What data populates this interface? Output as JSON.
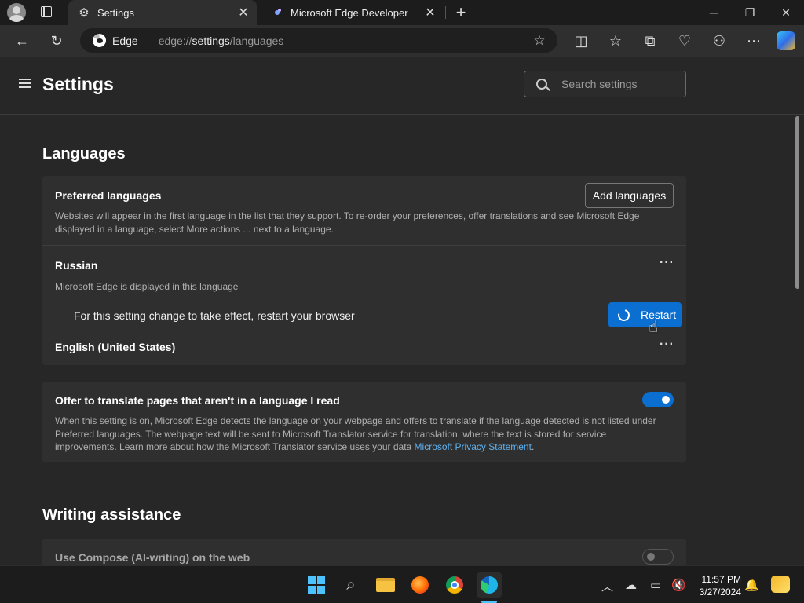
{
  "tabs": [
    {
      "title": "Settings",
      "icon": "gear-icon"
    },
    {
      "title": "Microsoft Edge Developer",
      "icon": "edge-dev-icon"
    }
  ],
  "window": {
    "minimize": "─",
    "restore": "❐",
    "close": "✕"
  },
  "addressbar": {
    "label": "Edge",
    "url_scheme": "edge://",
    "url_host": "settings",
    "url_path": "/languages"
  },
  "settings": {
    "title": "Settings",
    "search_placeholder": "Search settings"
  },
  "languages": {
    "section_title": "Languages",
    "preferred": {
      "title": "Preferred languages",
      "desc": "Websites will appear in the first language in the list that they support. To re-order your preferences, offer translations and see Microsoft Edge displayed in a language, select More actions ... next to a language.",
      "add_button": "Add languages"
    },
    "items": [
      {
        "name": "Russian",
        "note": "Microsoft Edge is displayed in this language"
      },
      {
        "name": "English (United States)"
      }
    ],
    "restart_message": "For this setting change to take effect, restart your browser",
    "restart_button": "Restart"
  },
  "translate": {
    "title": "Offer to translate pages that aren't in a language I read",
    "desc": "When this setting is on, Microsoft Edge detects the language on your webpage and offers to translate if the language detected is not listed under Preferred languages. The webpage text will be sent to Microsoft Translator service for translation, where the text is stored for service improvements. Learn more about how the Microsoft Translator service uses your data ",
    "link": "Microsoft Privacy Statement",
    "enabled": true
  },
  "writing": {
    "section_title": "Writing assistance",
    "compose_title": "Use Compose (AI-writing) on the web",
    "compose_enabled": false
  },
  "taskbar": {
    "time": "11:57 PM",
    "date": "3/27/2024",
    "apps": [
      "start-icon",
      "search-icon",
      "file-explorer-icon",
      "firefox-icon",
      "chrome-icon",
      "edge-icon"
    ]
  },
  "colors": {
    "accent": "#0b6fd1",
    "link": "#5fb2f2",
    "background": "#272727",
    "card": "#2f2f2f"
  }
}
